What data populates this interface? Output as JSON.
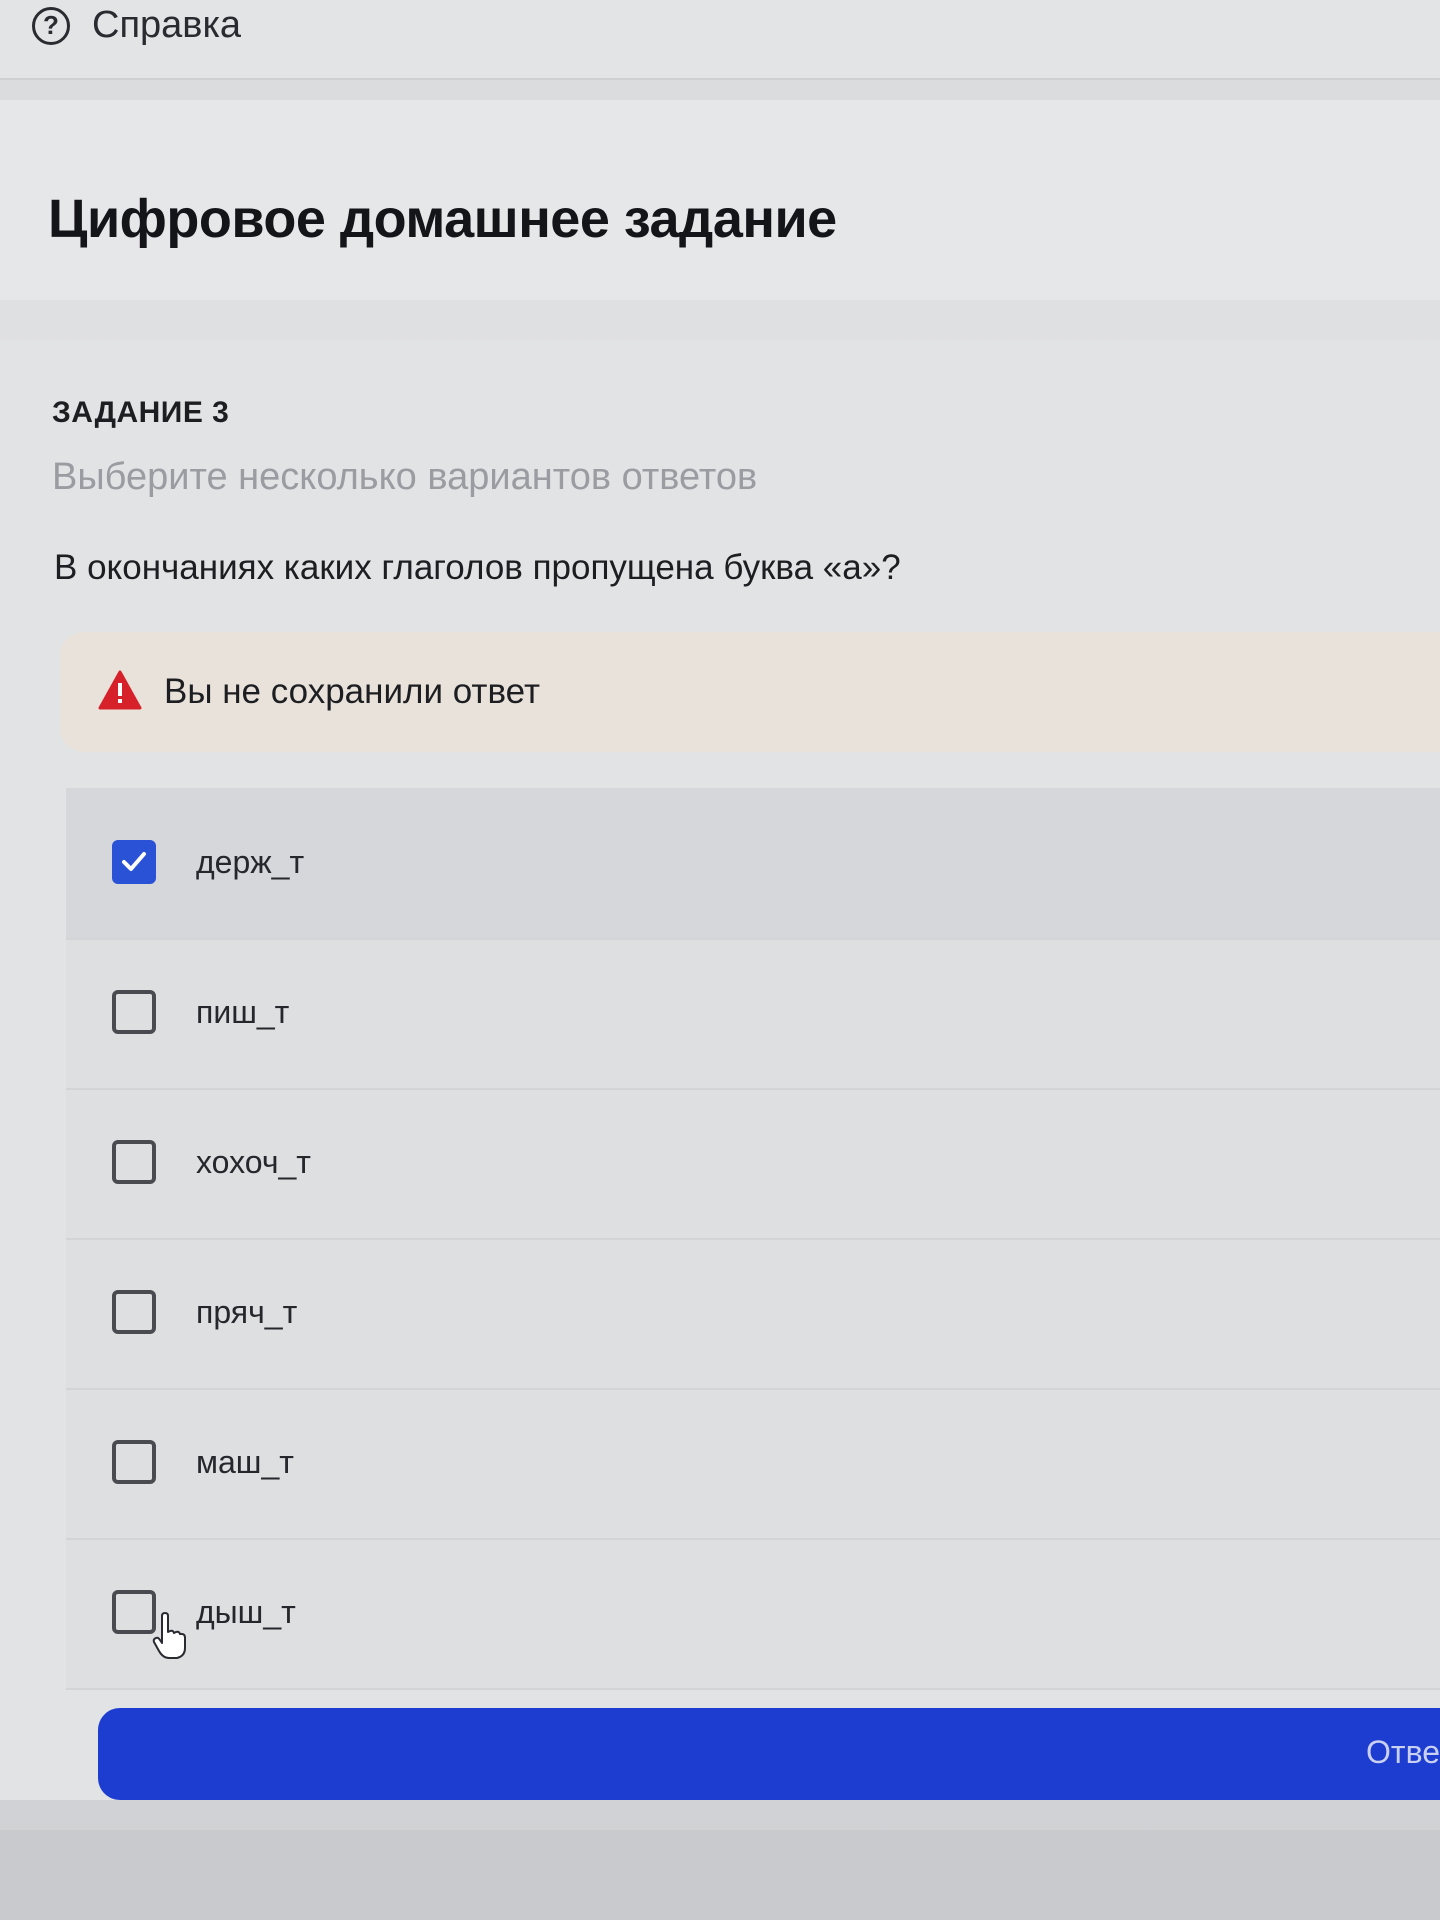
{
  "header": {
    "help_icon": "question-circle-icon",
    "help_label": "Справка"
  },
  "page": {
    "title": "Цифровое домашнее задание"
  },
  "task": {
    "number_label": "ЗАДАНИЕ 3",
    "hint": "Выберите несколько вариантов ответов",
    "question": "В окончаниях каких глаголов пропущена буква «а»?"
  },
  "warning": {
    "icon": "warning-triangle-icon",
    "text": "Вы не сохранили ответ"
  },
  "options": [
    {
      "label": "держ_т",
      "checked": true
    },
    {
      "label": "пиш_т",
      "checked": false
    },
    {
      "label": "хохоч_т",
      "checked": false
    },
    {
      "label": "пряч_т",
      "checked": false
    },
    {
      "label": "маш_т",
      "checked": false
    },
    {
      "label": "дыш_т",
      "checked": false
    }
  ],
  "submit": {
    "label": "Отве"
  },
  "colors": {
    "accent": "#1d3dd0",
    "checkbox_checked": "#2a52d6",
    "warning_bg": "#e9e2da",
    "warning_icon": "#d6202a"
  }
}
